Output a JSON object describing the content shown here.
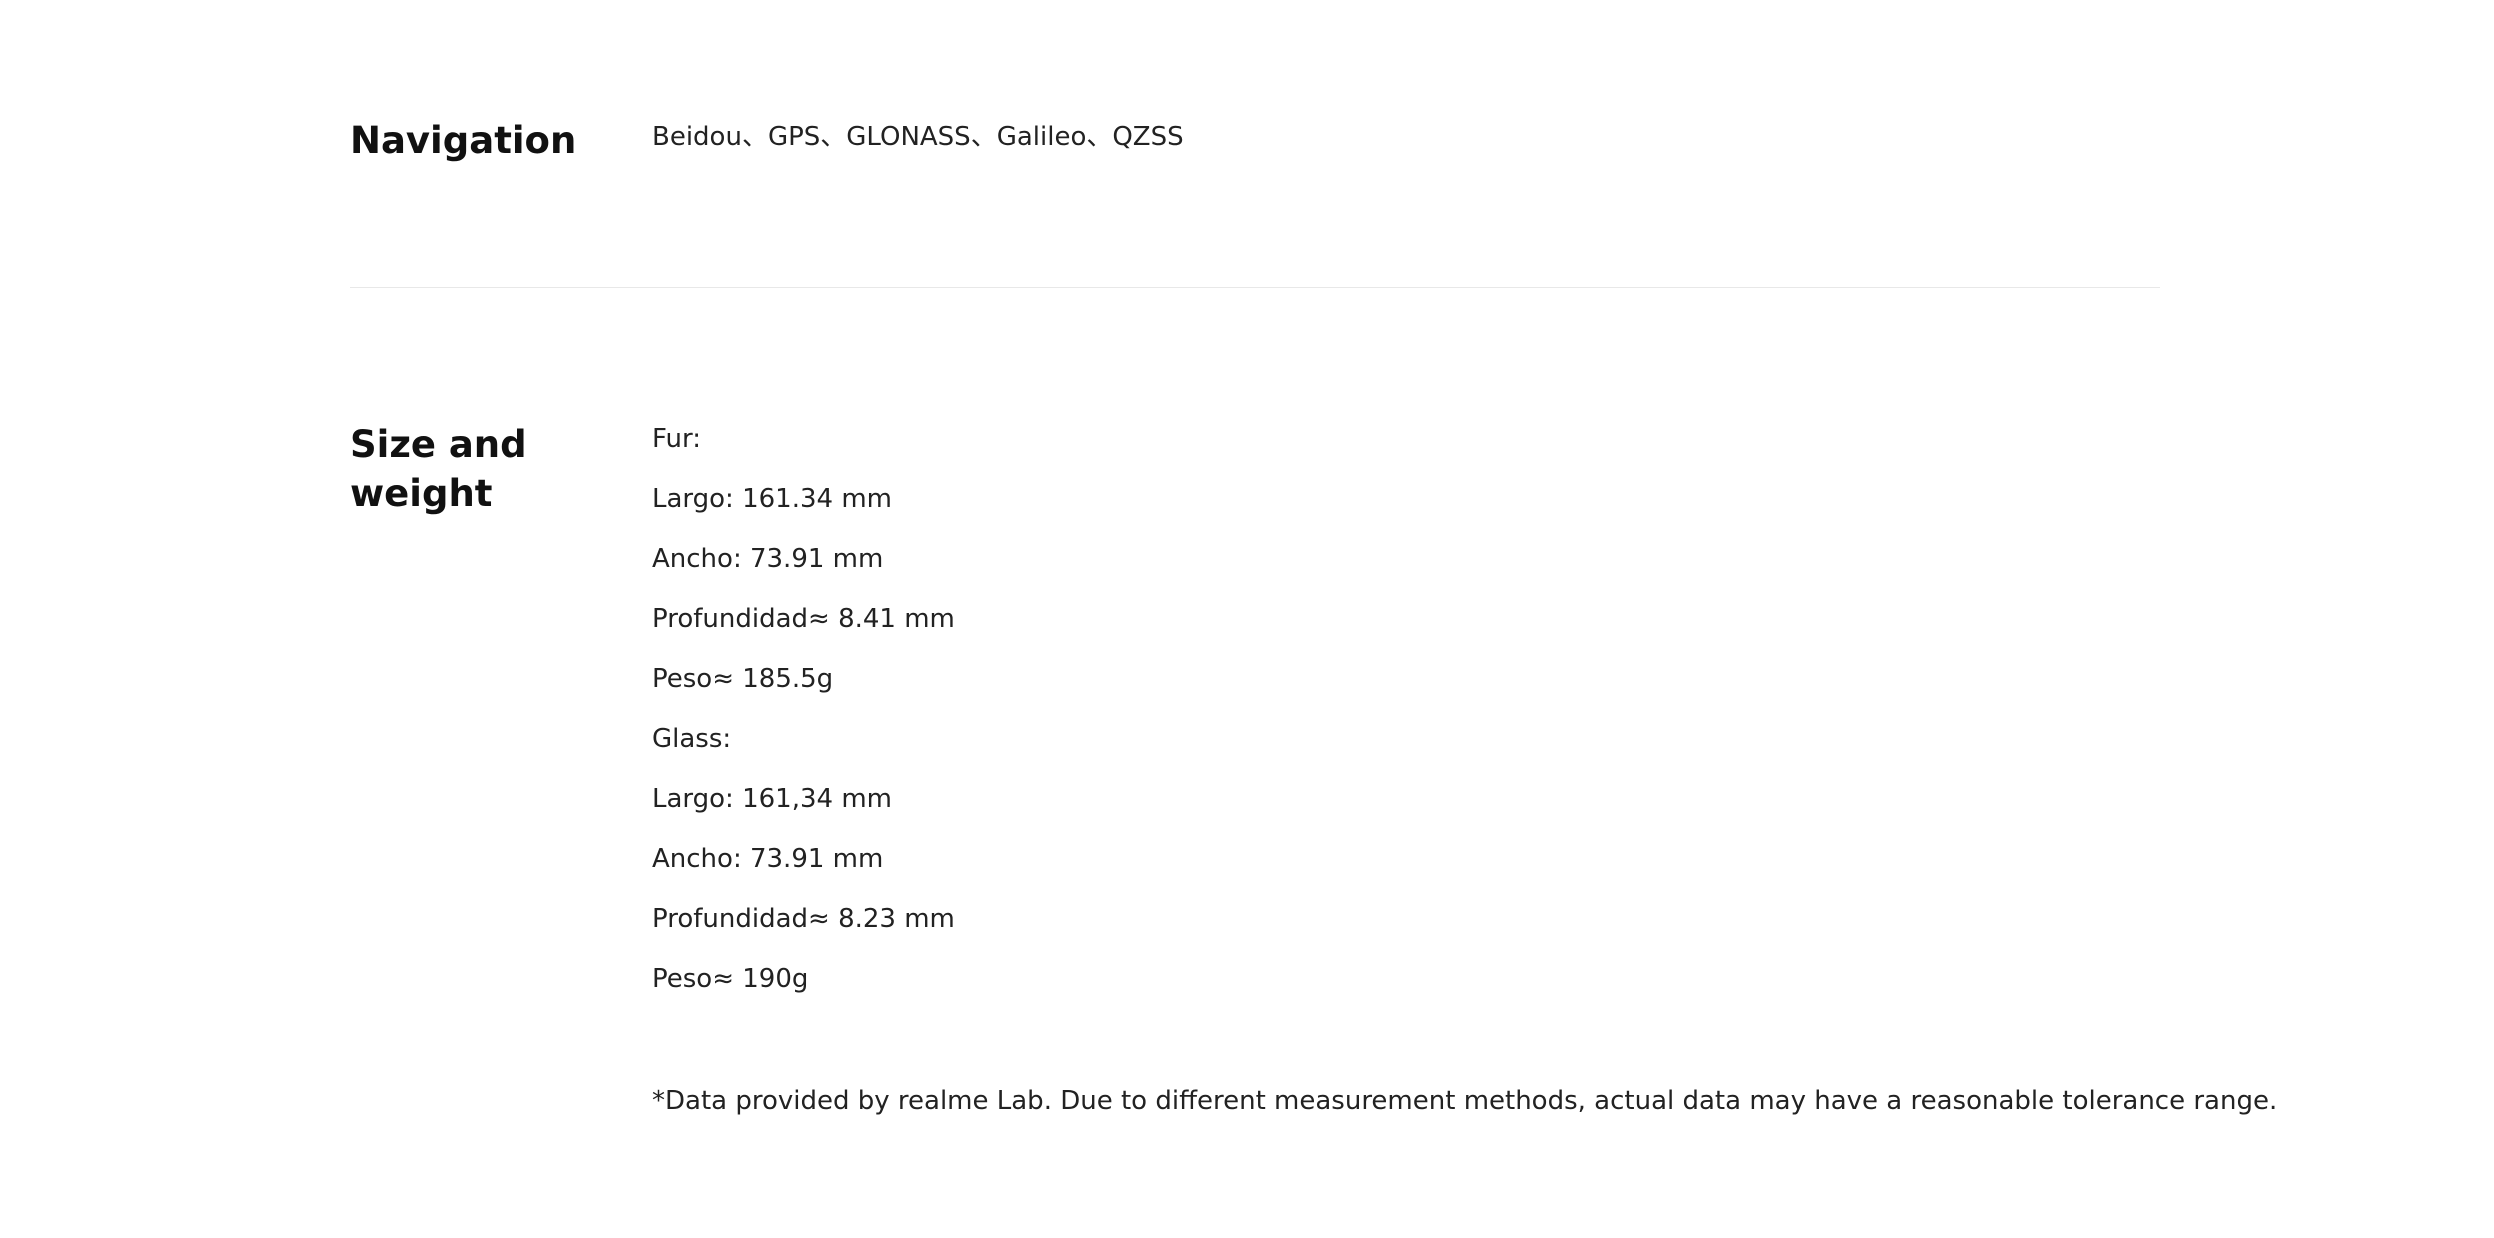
{
  "sections": {
    "navigation": {
      "title": "Navigation",
      "value": "Beidou、GPS、GLONASS、Galileo、QZSS"
    },
    "size_weight": {
      "title_line1": "Size and",
      "title_line2": "weight",
      "items": [
        "Fur:",
        "Largo: 161.34 mm",
        "Ancho: 73.91 mm",
        "Profundidad≈ 8.41 mm",
        "Peso≈ 185.5g",
        "Glass:",
        "Largo: 161,34 mm",
        "Ancho: 73.91 mm",
        "Profundidad≈ 8.23 mm",
        "Peso≈ 190g"
      ],
      "note": "*Data provided by realme Lab. Due to different measurement methods, actual data may have a reasonable tolerance range."
    }
  }
}
